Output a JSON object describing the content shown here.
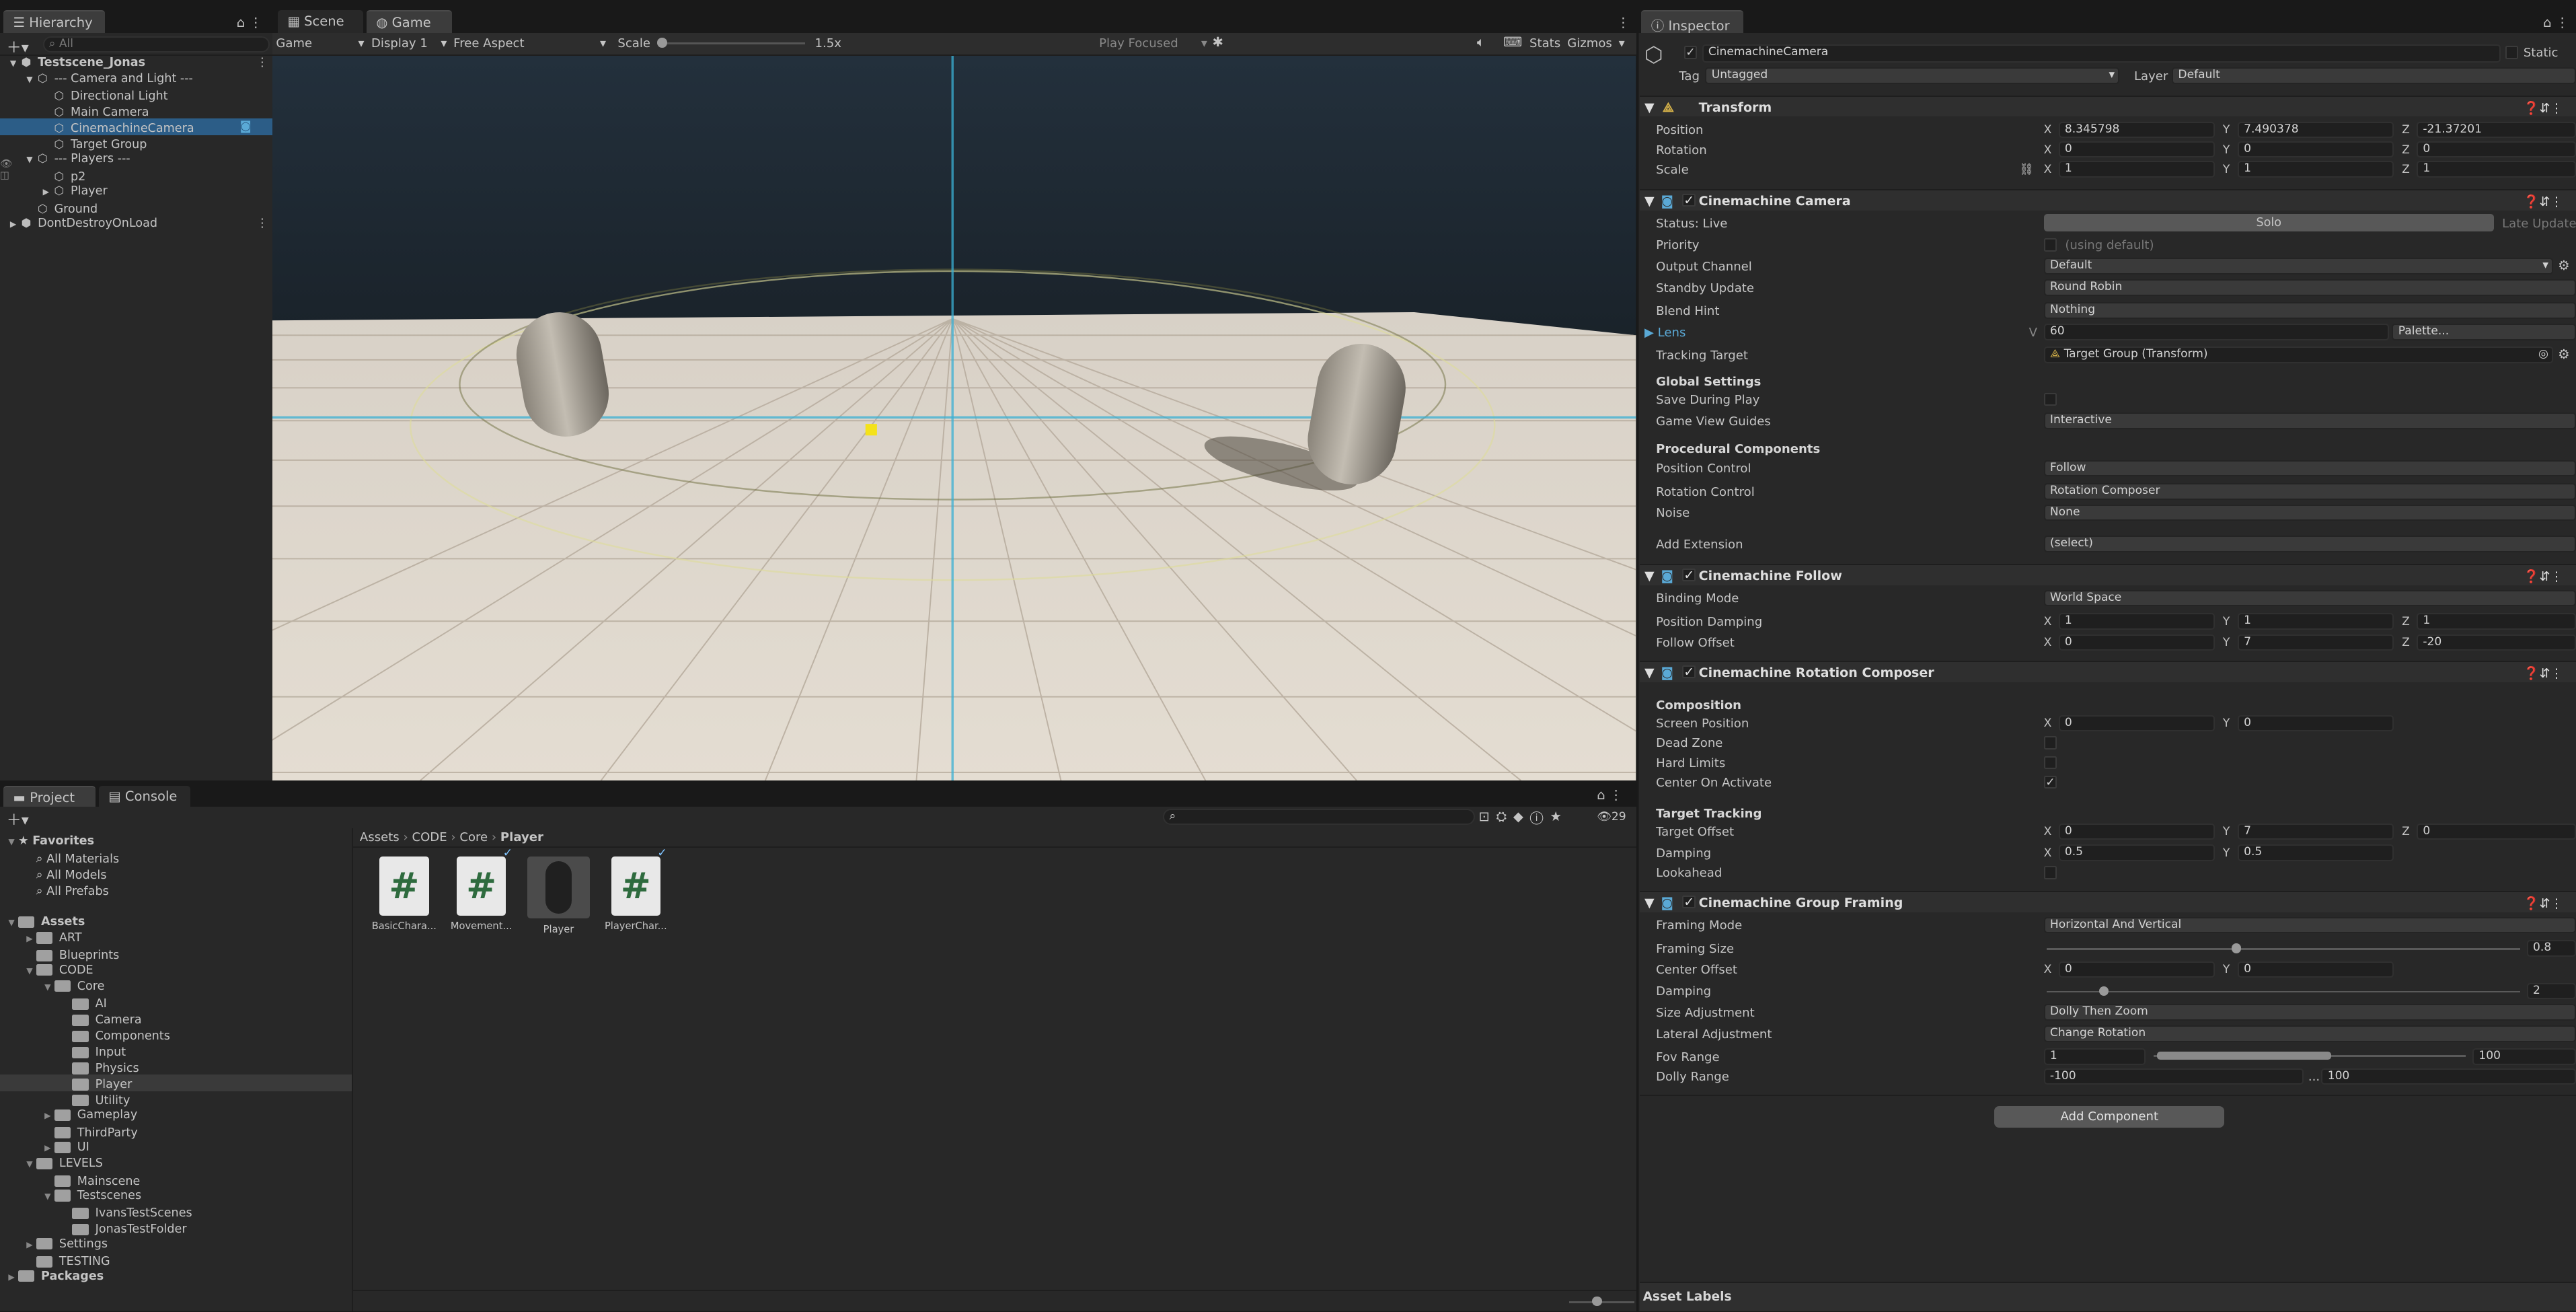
{
  "hierarchy": {
    "tab": "Hierarchy",
    "search_placeholder": "All",
    "items": [
      {
        "label": "Testscene_Jonas",
        "indent": 0,
        "arrow": "▼",
        "bold": true,
        "icon": "unity-scene-icon"
      },
      {
        "label": "--- Camera and Light ---",
        "indent": 1,
        "arrow": "▼",
        "icon": "gameobject-icon"
      },
      {
        "label": "Directional Light",
        "indent": 2,
        "arrow": "",
        "icon": "gameobject-icon"
      },
      {
        "label": "Main Camera",
        "indent": 2,
        "arrow": "",
        "icon": "gameobject-icon"
      },
      {
        "label": "CinemachineCamera",
        "indent": 2,
        "arrow": "",
        "icon": "gameobject-icon",
        "selected": true
      },
      {
        "label": "Target Group",
        "indent": 2,
        "arrow": "",
        "icon": "gameobject-icon"
      },
      {
        "label": "--- Players ---",
        "indent": 1,
        "arrow": "▼",
        "icon": "gameobject-icon"
      },
      {
        "label": "p2",
        "indent": 2,
        "arrow": "",
        "icon": "gameobject-icon"
      },
      {
        "label": "Player",
        "indent": 2,
        "arrow": "▶",
        "icon": "gameobject-icon"
      },
      {
        "label": "Ground",
        "indent": 1,
        "arrow": "",
        "icon": "gameobject-icon"
      },
      {
        "label": "DontDestroyOnLoad",
        "indent": 0,
        "arrow": "▶",
        "icon": "unity-scene-icon"
      }
    ]
  },
  "view": {
    "tabs": [
      "Scene",
      "Game"
    ],
    "game_dropdown": "Game",
    "display": "Display 1",
    "aspect": "Free Aspect",
    "scale_label": "Scale",
    "scale_value": "1.5x",
    "play_mode": "Play Focused",
    "stats": "Stats",
    "gizmos": "Gizmos"
  },
  "project": {
    "tabs": [
      "Project",
      "Console"
    ],
    "count": "29",
    "breadcrumb": [
      "Assets",
      "CODE",
      "Core",
      "Player"
    ],
    "tree": [
      {
        "label": "Favorites",
        "indent": 0,
        "arrow": "▼",
        "kind": "star",
        "bold": true
      },
      {
        "label": "All Materials",
        "indent": 1,
        "arrow": "",
        "kind": "search"
      },
      {
        "label": "All Models",
        "indent": 1,
        "arrow": "",
        "kind": "search"
      },
      {
        "label": "All Prefabs",
        "indent": 1,
        "arrow": "",
        "kind": "search"
      },
      {
        "label": "",
        "indent": 0,
        "arrow": "",
        "kind": "gap"
      },
      {
        "label": "Assets",
        "indent": 0,
        "arrow": "▼",
        "kind": "folder",
        "bold": true
      },
      {
        "label": "ART",
        "indent": 1,
        "arrow": "▶",
        "kind": "folder"
      },
      {
        "label": "Blueprints",
        "indent": 1,
        "arrow": "",
        "kind": "folder"
      },
      {
        "label": "CODE",
        "indent": 1,
        "arrow": "▼",
        "kind": "folder"
      },
      {
        "label": "Core",
        "indent": 2,
        "arrow": "▼",
        "kind": "folder"
      },
      {
        "label": "AI",
        "indent": 3,
        "arrow": "",
        "kind": "folder"
      },
      {
        "label": "Camera",
        "indent": 3,
        "arrow": "",
        "kind": "folder"
      },
      {
        "label": "Components",
        "indent": 3,
        "arrow": "",
        "kind": "folder"
      },
      {
        "label": "Input",
        "indent": 3,
        "arrow": "",
        "kind": "folder"
      },
      {
        "label": "Physics",
        "indent": 3,
        "arrow": "",
        "kind": "folder"
      },
      {
        "label": "Player",
        "indent": 3,
        "arrow": "",
        "kind": "folder",
        "selected": true
      },
      {
        "label": "Utility",
        "indent": 3,
        "arrow": "",
        "kind": "folder"
      },
      {
        "label": "Gameplay",
        "indent": 2,
        "arrow": "▶",
        "kind": "folder"
      },
      {
        "label": "ThirdParty",
        "indent": 2,
        "arrow": "",
        "kind": "folder"
      },
      {
        "label": "UI",
        "indent": 2,
        "arrow": "▶",
        "kind": "folder"
      },
      {
        "label": "LEVELS",
        "indent": 1,
        "arrow": "▼",
        "kind": "folder"
      },
      {
        "label": "Mainscene",
        "indent": 2,
        "arrow": "",
        "kind": "folder"
      },
      {
        "label": "Testscenes",
        "indent": 2,
        "arrow": "▼",
        "kind": "folder"
      },
      {
        "label": "IvansTestScenes",
        "indent": 3,
        "arrow": "",
        "kind": "folder"
      },
      {
        "label": "JonasTestFolder",
        "indent": 3,
        "arrow": "",
        "kind": "folder"
      },
      {
        "label": "Settings",
        "indent": 1,
        "arrow": "▶",
        "kind": "folder"
      },
      {
        "label": "TESTING",
        "indent": 1,
        "arrow": "",
        "kind": "folder"
      },
      {
        "label": "Packages",
        "indent": 0,
        "arrow": "▶",
        "kind": "folder",
        "bold": true
      }
    ],
    "assets": [
      {
        "label": "BasicChara...",
        "kind": "script"
      },
      {
        "label": "Movement...",
        "kind": "script",
        "check": true
      },
      {
        "label": "Player",
        "kind": "prefab"
      },
      {
        "label": "PlayerChar...",
        "kind": "script",
        "check": true
      }
    ]
  },
  "inspector": {
    "tab": "Inspector",
    "object_name": "CinemachineCamera",
    "static": "Static",
    "tag_label": "Tag",
    "tag": "Untagged",
    "layer_label": "Layer",
    "layer": "Default",
    "transform": {
      "title": "Transform",
      "position_label": "Position",
      "rotation_label": "Rotation",
      "scale_label": "Scale",
      "position": [
        "8.345798",
        "7.490378",
        "-21.37201"
      ],
      "rotation": [
        "0",
        "0",
        "0"
      ],
      "scale": [
        "1",
        "1",
        "1"
      ]
    },
    "cm_camera": {
      "title": "Cinemachine Camera",
      "status": "Status: Live",
      "solo": "Solo",
      "late_update": "Late Update",
      "priority_label": "Priority",
      "priority_hint": "(using default)",
      "output_label": "Output Channel",
      "output": "Default",
      "standby_label": "Standby Update",
      "standby": "Round Robin",
      "blend_label": "Blend Hint",
      "blend": "Nothing",
      "lens_label": "Lens",
      "lens_v": "V",
      "lens": "60",
      "palette": "Palette...",
      "tracking_label": "Tracking Target",
      "tracking": "Target Group (Transform)",
      "global_title": "Global Settings",
      "save_label": "Save During Play",
      "guides_label": "Game View Guides",
      "guides": "Interactive",
      "proc_title": "Procedural Components",
      "poscontrol_label": "Position Control",
      "poscontrol": "Follow",
      "rotcontrol_label": "Rotation Control",
      "rotcontrol": "Rotation Composer",
      "noise_label": "Noise",
      "noise": "None",
      "ext_label": "Add Extension",
      "ext": "(select)"
    },
    "follow": {
      "title": "Cinemachine Follow",
      "binding_label": "Binding Mode",
      "binding": "World Space",
      "damping_label": "Position Damping",
      "damping": [
        "1",
        "1",
        "1"
      ],
      "offset_label": "Follow Offset",
      "offset": [
        "0",
        "7",
        "-20"
      ]
    },
    "composer": {
      "title": "Cinemachine Rotation Composer",
      "comp_title": "Composition",
      "screen_label": "Screen Position",
      "screen": [
        "0",
        "0"
      ],
      "dead_label": "Dead Zone",
      "hard_label": "Hard Limits",
      "center_label": "Center On Activate",
      "tt_title": "Target Tracking",
      "toffset_label": "Target Offset",
      "toffset": [
        "0",
        "7",
        "0"
      ],
      "damp_label": "Damping",
      "damp": [
        "0.5",
        "0.5"
      ],
      "look_label": "Lookahead"
    },
    "framing": {
      "title": "Cinemachine Group Framing",
      "mode_label": "Framing Mode",
      "mode": "Horizontal And Vertical",
      "size_label": "Framing Size",
      "size": "0.8",
      "size_frac": 0.4,
      "coff_label": "Center Offset",
      "coff": [
        "0",
        "0"
      ],
      "damp_label": "Damping",
      "damp": "2",
      "damp_frac": 0.12,
      "sizeadj_label": "Size Adjustment",
      "sizeadj": "Dolly Then Zoom",
      "latadj_label": "Lateral Adjustment",
      "latadj": "Change Rotation",
      "fov_label": "Fov Range",
      "fov": [
        "1",
        "100"
      ],
      "dolly_label": "Dolly Range",
      "dolly": [
        "-100",
        "100"
      ],
      "dolly_sep": "..."
    },
    "add_component": "Add Component",
    "asset_labels": "Asset Labels"
  },
  "axis": {
    "x": "X",
    "y": "Y",
    "z": "Z"
  }
}
